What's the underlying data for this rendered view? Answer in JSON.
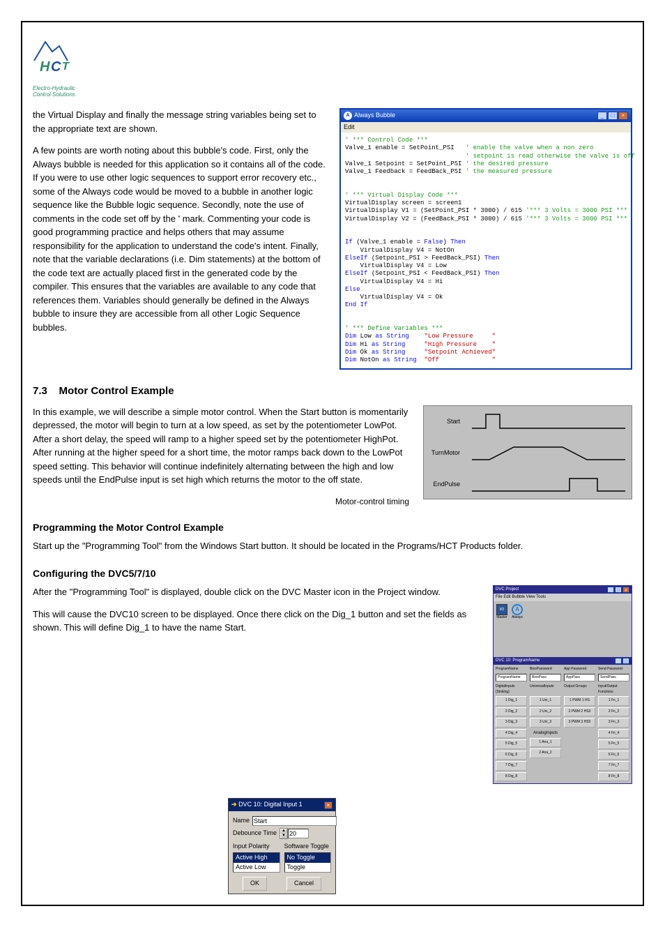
{
  "logo": {
    "line1": "Electro-Hydraulic",
    "line2": "Control Solutions"
  },
  "paragraphs": {
    "p1a": "the Virtual Display and finally the message string ",
    "p1b": "variables being set to the appropriate text are shown.",
    "p2": "A few points are worth noting about this bubble's code. First, only the Always bubble is needed for this application so it contains all of the code. If you were to use other logic sequences to support error recovery etc., some of the Always code would be moved to a bubble in another logic sequence like the Bubble logic sequence. Secondly, note the use of comments in the code set off by the ' mark. Commenting your code is good programming practice and helps others that may assume responsibility for the application to understand the code's intent. Finally, note that the variable declarations (i.e. Dim statements) at the bottom of the code text are actually placed first in the generated code by the compiler. This ensures that the variables are available to any code that references them. Variables should generally be defined in the Always bubble to insure they are accessible from all other Logic Sequence bubbles.",
    "p3": "In this example, we will describe a simple motor control. When the Start button is momentarily depressed, the motor will begin to turn at a low speed, as set by the potentiometer LowPot. After a short delay, the speed will ramp to a higher speed set by the potentiometer HighPot. After running at the higher speed for a short time, the motor ramps back down to the LowPot speed setting. This behavior will continue indefinitely alternating between the high and low speeds until the EndPulse input is set high which returns the motor to the off state.",
    "p4": "Start up the \"Programming Tool\" from the Windows Start button. It should be located in the Programs/HCT Products folder.",
    "p5": "After the \"Programming Tool\" is displayed, double click on the DVC Master icon in the Project window.",
    "p6": "This will cause the DVC10 screen to be displayed. Once there click on the Dig_1 button and set the fields as shown. This will define Dig_1 to have the name Start."
  },
  "section": {
    "num": "7.3",
    "title": "Motor Control Example"
  },
  "sub": {
    "title": "Programming the Motor Control Example",
    "timing_label": "Motor-control timing",
    "config_label": "Configuring the DVC5/7/10"
  },
  "timing": {
    "r1": "Start",
    "r2": "TurnMotor",
    "r3": "EndPulse"
  },
  "code_window": {
    "title": "Always Bubble",
    "menu": "Edit",
    "lines": [
      {
        "t": "' *** Control Code ***",
        "c": "cg"
      },
      {
        "seg": [
          {
            "t": "Valve_1 enable = SetPoint_PSI   "
          },
          {
            "t": "' enable the valve when a non zero",
            "c": "cg"
          }
        ]
      },
      {
        "seg": [
          {
            "t": "                                "
          },
          {
            "t": "' setpoint is read otherwise the valve is off",
            "c": "cg"
          }
        ]
      },
      {
        "seg": [
          {
            "t": "Valve_1 Setpoint = SetPoint_PSI "
          },
          {
            "t": "' the desired pressure",
            "c": "cg"
          }
        ]
      },
      {
        "seg": [
          {
            "t": "Valve_1 Feedback = FeedBack_PSI "
          },
          {
            "t": "' the measured pressure",
            "c": "cg"
          }
        ]
      },
      {
        "t": ""
      },
      {
        "t": ""
      },
      {
        "t": "' *** Virtual Display Code ***",
        "c": "cg"
      },
      {
        "t": "VirtualDisplay screen = screen1"
      },
      {
        "seg": [
          {
            "t": "VirtualDisplay V1 = (SetPoint_PSI * 3000) / 615 "
          },
          {
            "t": "'*** 3 Volts = 3000 PSI ***",
            "c": "cg"
          }
        ]
      },
      {
        "seg": [
          {
            "t": "VirtualDisplay V2 = (FeedBack_PSI * 3000) / 615 "
          },
          {
            "t": "'*** 3 Volts = 3000 PSI ***",
            "c": "cg"
          }
        ]
      },
      {
        "t": ""
      },
      {
        "t": ""
      },
      {
        "seg": [
          {
            "t": "If ",
            "c": "cb"
          },
          {
            "t": "(Valve_1 enable = "
          },
          {
            "t": "False",
            "c": "cb"
          },
          {
            "t": ") "
          },
          {
            "t": "Then",
            "c": "cb"
          }
        ]
      },
      {
        "t": "    VirtualDisplay V4 = NotOn"
      },
      {
        "seg": [
          {
            "t": "ElseIf ",
            "c": "cb"
          },
          {
            "t": "(Setpoint_PSI > FeedBack_PSI) "
          },
          {
            "t": "Then",
            "c": "cb"
          }
        ]
      },
      {
        "t": "    VirtualDisplay V4 = Low"
      },
      {
        "seg": [
          {
            "t": "ElseIf ",
            "c": "cb"
          },
          {
            "t": "(Setpoint_PSI < FeedBack_PSI) "
          },
          {
            "t": "Then",
            "c": "cb"
          }
        ]
      },
      {
        "t": "    VirtualDisplay V4 = Hi"
      },
      {
        "t": "Else",
        "c": "cb"
      },
      {
        "t": "    VirtualDisplay V4 = Ok"
      },
      {
        "t": "End If",
        "c": "cb"
      },
      {
        "t": ""
      },
      {
        "t": ""
      },
      {
        "t": "' *** Define Variables ***",
        "c": "cg"
      },
      {
        "seg": [
          {
            "t": "Dim ",
            "c": "cb"
          },
          {
            "t": "Low "
          },
          {
            "t": "as String",
            "c": "cb"
          },
          {
            "t": "    "
          },
          {
            "t": "\"Low Pressure     \"",
            "c": "cr"
          }
        ]
      },
      {
        "seg": [
          {
            "t": "Dim ",
            "c": "cb"
          },
          {
            "t": "Hi "
          },
          {
            "t": "as String",
            "c": "cb"
          },
          {
            "t": "     "
          },
          {
            "t": "\"High Pressure    \"",
            "c": "cr"
          }
        ]
      },
      {
        "seg": [
          {
            "t": "Dim ",
            "c": "cb"
          },
          {
            "t": "Ok "
          },
          {
            "t": "as String",
            "c": "cb"
          },
          {
            "t": "     "
          },
          {
            "t": "\"Setpoint Achieved\"",
            "c": "cr"
          }
        ]
      },
      {
        "seg": [
          {
            "t": "Dim ",
            "c": "cb"
          },
          {
            "t": "NotOn "
          },
          {
            "t": "as String",
            "c": "cb"
          },
          {
            "t": "  "
          },
          {
            "t": "\"Off              \"",
            "c": "cr"
          }
        ]
      }
    ]
  },
  "proj": {
    "title": "DVC Project",
    "menu": "File  Edit  Bubble  View  Tools",
    "form_title": "DVC 10: ProgramName",
    "headers": [
      "ProgramName",
      "BiosPassword",
      "App Password",
      "Send Password"
    ],
    "fields": [
      "ProgramName",
      "BiosPass",
      "AppPass",
      "SendPass"
    ],
    "group_labels": [
      "DigitalInputs (Sinking)",
      "UniversalInputs",
      "Output Groups",
      "Input/Output Functions"
    ],
    "dig": [
      "1 Dig_1",
      "2 Dig_2",
      "3 Dig_3",
      "4 Dig_4",
      "5 Dig_5",
      "6 Dig_6",
      "7 Dig_7",
      "8 Dig_8"
    ],
    "uni": [
      "1 Uni_1",
      "2 Uni_2",
      "3 Uni_3"
    ],
    "ogrp": [
      "1 PWM 1\nHS",
      "2 PWM 2\nHS3",
      "3 PWM 3\nHS5"
    ],
    "analog": [
      "1 Ana_1",
      "2 Ana_2"
    ],
    "analog_label": "AnalogInputs",
    "fn": [
      "1 Fn_1",
      "2 Fn_2",
      "3 Fn_3",
      "4 Fn_4",
      "5 Fn_5",
      "6 Fn_6",
      "7 Fn_7",
      "8 Fn_8"
    ],
    "icons": {
      "master": "I/O",
      "master_label": "Master",
      "always": "A",
      "always_label": "Always"
    }
  },
  "di": {
    "title": "DVC 10: Digital Input 1",
    "name_label": "Name",
    "name_value": "Start",
    "debounce_label": "Debounce Time",
    "debounce_value": "20",
    "polarity_label": "Input Polarity",
    "toggle_label": "Software Toggle",
    "polarity": [
      "Active High",
      "Active Low"
    ],
    "toggle": [
      "No Toggle",
      "Toggle"
    ],
    "ok": "OK",
    "cancel": "Cancel"
  }
}
